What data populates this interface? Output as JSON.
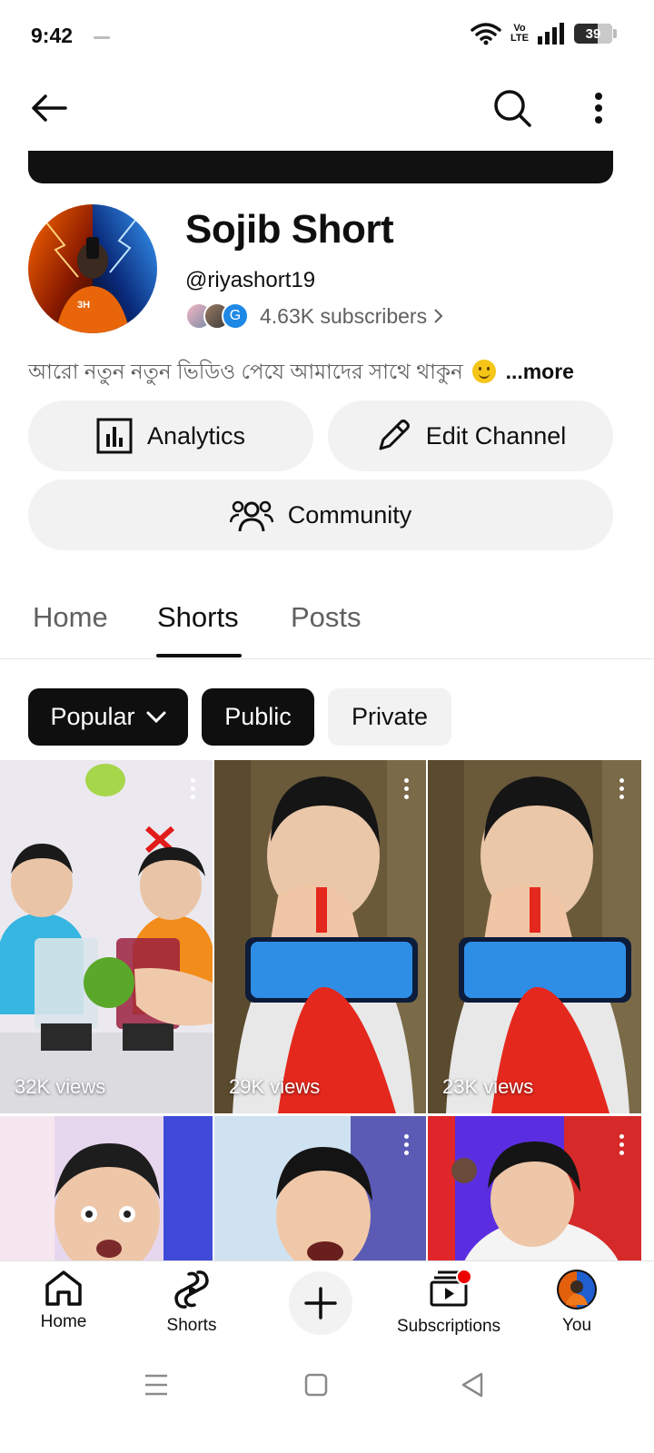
{
  "status_bar": {
    "time": "9:42",
    "network_label_top": "Vo",
    "network_label_bottom": "LTE",
    "battery": "39"
  },
  "channel": {
    "name": "Sojib Short",
    "handle": "@riyashort19",
    "subscribers": "4.63K subscribers",
    "description": "আরো নতুন নতুন ভিডিও পেযে আমাদের সাথে থাকুন",
    "more_label": "...more",
    "subscriber_avatar_letter": "G"
  },
  "actions": {
    "analytics": "Analytics",
    "edit_channel": "Edit Channel",
    "community": "Community"
  },
  "tabs": [
    {
      "label": "Home",
      "active": false
    },
    {
      "label": "Shorts",
      "active": true
    },
    {
      "label": "Posts",
      "active": false
    }
  ],
  "filters": {
    "sort": "Popular",
    "public": "Public",
    "private": "Private"
  },
  "shorts": [
    {
      "views": "32K views"
    },
    {
      "views": "29K views"
    },
    {
      "views": "23K views"
    },
    {
      "views": ""
    },
    {
      "views": ""
    },
    {
      "views": ""
    }
  ],
  "bottom_nav": {
    "home": "Home",
    "shorts": "Shorts",
    "subscriptions": "Subscriptions",
    "you": "You"
  },
  "colors": {
    "accent_dark": "#0f0f0f",
    "chip_light": "#f2f2f2",
    "secondary_text": "#606060",
    "notification": "#ee0000"
  }
}
